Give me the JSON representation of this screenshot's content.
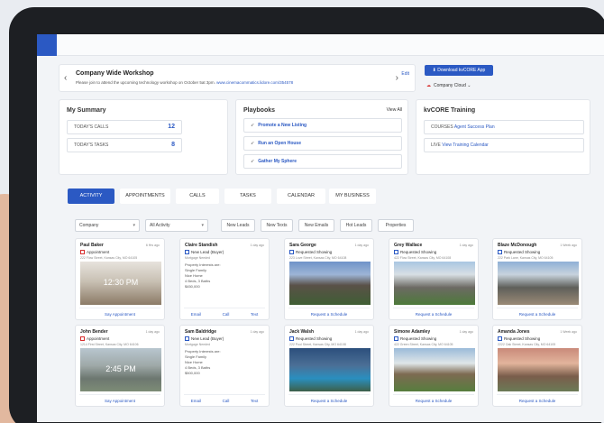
{
  "banner": {
    "title": "Company Wide Workshop",
    "message": "Please join to attend the upcoming technology workshop on October 5at 3pm.",
    "link": "www.cinemacommatics.lidore.com/354578",
    "edit": "Edit"
  },
  "download_button": "Download kvCORE App",
  "company_cloud": "Company Cloud",
  "summary": {
    "title": "My Summary",
    "rows": [
      {
        "label": "TODAY'S CALLS",
        "value": "12"
      },
      {
        "label": "TODAY'S TASKS",
        "value": "8"
      }
    ]
  },
  "playbooks": {
    "title": "Playbooks",
    "view_all": "View All",
    "items": [
      "Promote a New Listing",
      "Run an Open House",
      "Gather My Sphere"
    ]
  },
  "training": {
    "title": "kvCORE Training",
    "rows": [
      {
        "label": "COURSES",
        "link": "Agent Success Plan"
      },
      {
        "label": "LIVE",
        "link": "View Training Calendar"
      }
    ]
  },
  "tabs": [
    "ACTIVITY",
    "APPOINTMENTS",
    "CALLS",
    "TASKS",
    "CALENDAR",
    "MY BUSINESS"
  ],
  "filters": {
    "company": "Company",
    "activity": "All Activity",
    "buttons": [
      "New Leads",
      "New Texts",
      "New Emails",
      "Hot Leads",
      "Properties"
    ]
  },
  "cards": [
    {
      "name": "Paul Baker",
      "date": "6 Hrs ago",
      "type": "Appointment",
      "addr": "222 Flow Street, Kansas City, MO 64105",
      "time": "12:30 PM",
      "foot": "Say Appointment",
      "icon": "red"
    },
    {
      "name": "Claire Standish",
      "date": "1 day ago",
      "type": "New Lead (Buyer)",
      "addr": "Mortgage Needed",
      "lines": [
        "Property Interests are:",
        "Single Family",
        "Nice Home",
        "4 Beds, 3 Baths",
        "$450,000"
      ],
      "actions": [
        "Email",
        "Call",
        "Text"
      ]
    },
    {
      "name": "Sara George",
      "date": "1 day ago",
      "type": "Requested Showing",
      "addr": "223 Love Street, Kansas City, MO 64108",
      "foot": "Request a Schedule"
    },
    {
      "name": "Grey Wallace",
      "date": "1 day ago",
      "type": "Requested Showing",
      "addr": "422 Flow Street, Kansas City, MO 64108",
      "foot": "Request a Schedule"
    },
    {
      "name": "Blaze McDonough",
      "date": "1 Week ago",
      "type": "Requested Showing",
      "addr": "222 Park Lane, Kansas City, MO 64105",
      "foot": "Request a Schedule"
    },
    {
      "name": "John Bender",
      "date": "1 day ago",
      "type": "Appointment",
      "addr": "1214 First Street, Kansas City, MO 64106",
      "time": "2:45 PM",
      "foot": "Say Appointment",
      "icon": "red"
    },
    {
      "name": "Sam Baldridge",
      "date": "1 day ago",
      "type": "New Lead (Buyer)",
      "addr": "Mortgage Needed",
      "lines": [
        "Property Interests are:",
        "Single Family",
        "Nice Home",
        "4 Beds, 3 Baths",
        "$500,000"
      ],
      "actions": [
        "Email",
        "Call",
        "Text"
      ]
    },
    {
      "name": "Jack Walsh",
      "date": "1 day ago",
      "type": "Requested Showing",
      "addr": "222 Pool Street, Kansas City, MO 64108",
      "foot": "Request a Schedule"
    },
    {
      "name": "Simone Adamley",
      "date": "1 day ago",
      "type": "Requested Showing",
      "addr": "422 Green Street, Kansas City, MO 64105",
      "foot": "Request a Schedule"
    },
    {
      "name": "Amanda Jones",
      "date": "1 Week ago",
      "type": "Requested Showing",
      "addr": "2222 Oak Street, Kansas City, MO 64105",
      "foot": "Request a Schedule"
    }
  ],
  "colors": {
    "accent": "#2b59c3",
    "alert": "#d62d2d"
  }
}
